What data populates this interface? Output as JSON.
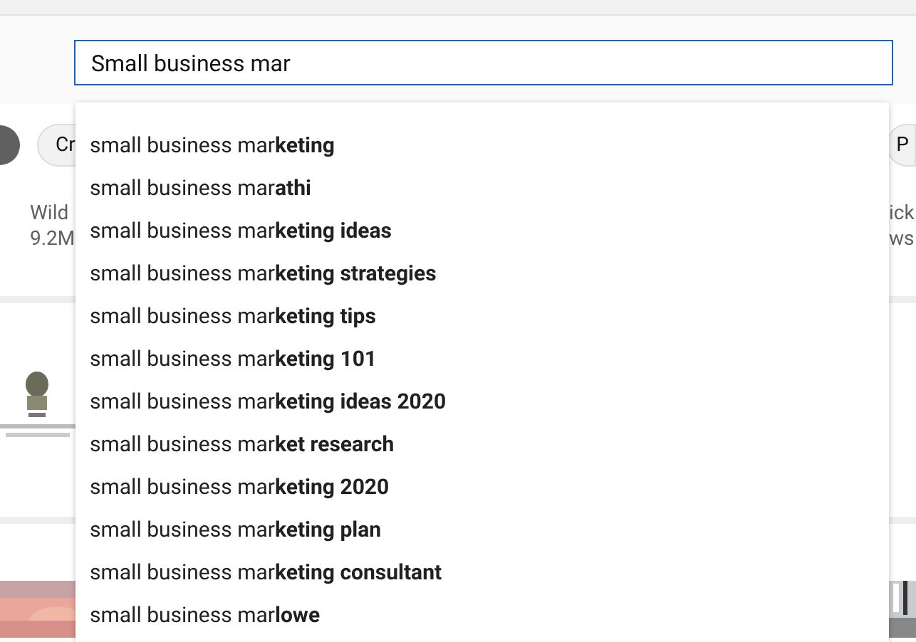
{
  "search": {
    "value": "Small business mar"
  },
  "suggestions": [
    "small business mar**keting**",
    "small business mar**athi**",
    "small business mar**keting ideas**",
    "small business mar**keting strategies**",
    "small business mar**keting tips**",
    "small business mar**keting 101**",
    "small business mar**keting ideas 2020**",
    "small business mar**ket research**",
    "small business mar**keting 2020**",
    "small business mar**keting plan**",
    "small business mar**keting consultant**",
    "small business mar**lowe**"
  ],
  "chips": [
    {
      "label": "Cr"
    },
    {
      "label": "P"
    }
  ],
  "videos": [
    {
      "kind": "text",
      "lines": [
        "Wild",
        "9.2M"
      ]
    },
    {
      "kind": "text",
      "lines": [
        "ick",
        "ws"
      ]
    },
    {
      "kind": "picture"
    }
  ]
}
